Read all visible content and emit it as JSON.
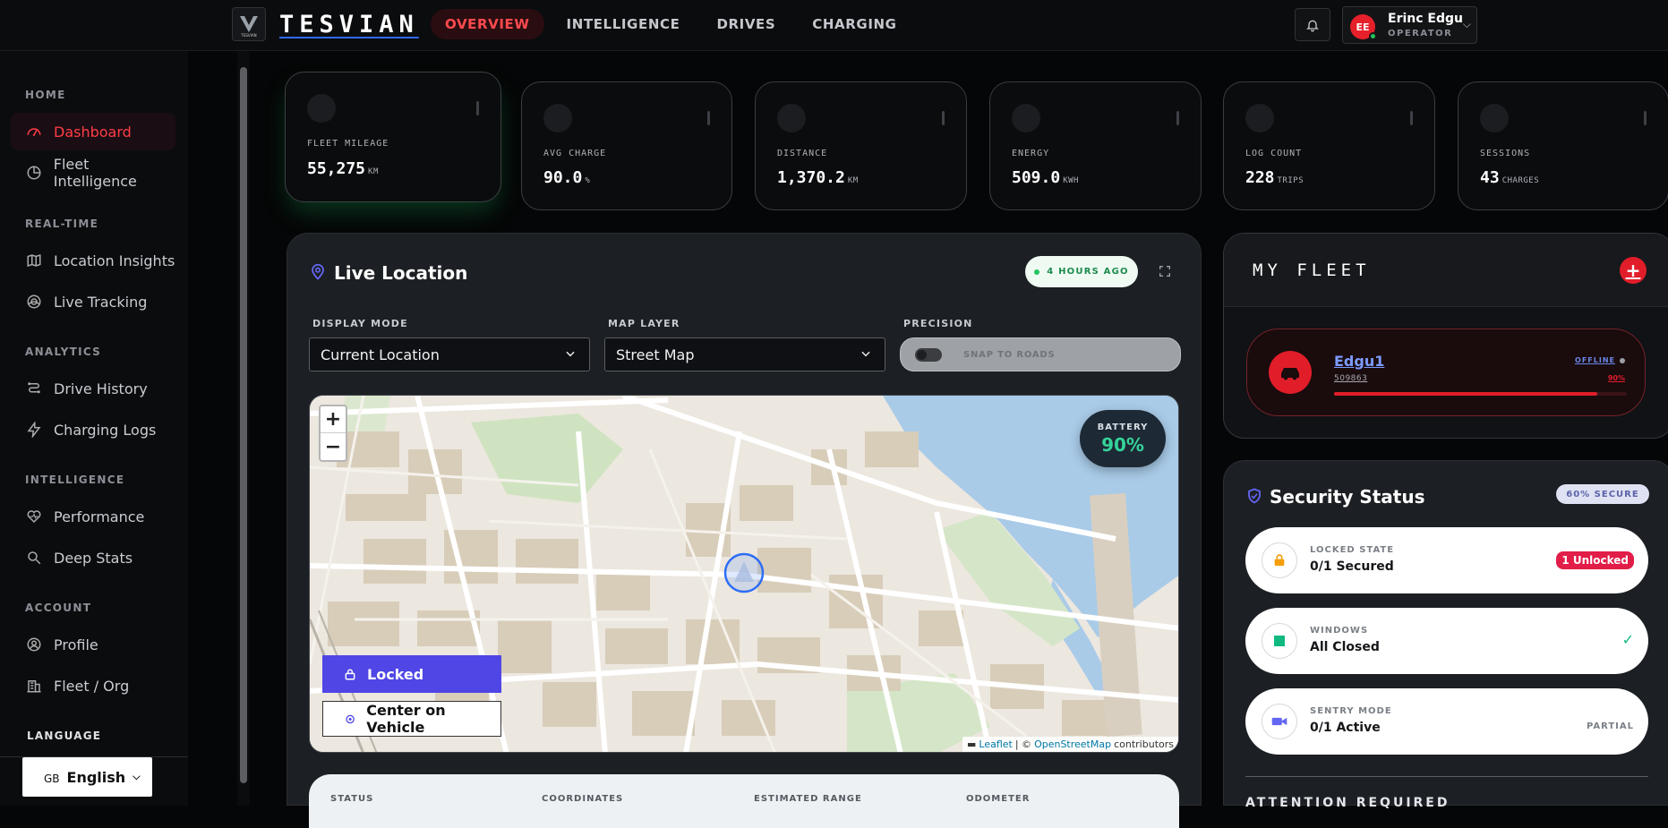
{
  "header": {
    "brand": "TESVIAN",
    "logo_text": "TESVIAN",
    "tabs": [
      {
        "label": "OVERVIEW",
        "active": true
      },
      {
        "label": "INTELLIGENCE",
        "active": false
      },
      {
        "label": "DRIVES",
        "active": false
      },
      {
        "label": "CHARGING",
        "active": false
      }
    ],
    "user": {
      "initials": "EE",
      "name": "Erinc Edgu",
      "role": "OPERATOR"
    }
  },
  "sidebar": {
    "sections": [
      {
        "title": "HOME",
        "items": [
          {
            "label": "Dashboard",
            "icon": "gauge-icon",
            "active": true
          },
          {
            "label": "Fleet Intelligence",
            "icon": "pie-chart-icon",
            "active": false
          }
        ]
      },
      {
        "title": "REAL-TIME",
        "items": [
          {
            "label": "Location Insights",
            "icon": "map-icon",
            "active": false
          },
          {
            "label": "Live Tracking",
            "icon": "radar-icon",
            "active": false
          }
        ]
      },
      {
        "title": "ANALYTICS",
        "items": [
          {
            "label": "Drive History",
            "icon": "route-icon",
            "active": false
          },
          {
            "label": "Charging Logs",
            "icon": "bolt-icon",
            "active": false
          }
        ]
      },
      {
        "title": "INTELLIGENCE",
        "items": [
          {
            "label": "Performance",
            "icon": "heart-pulse-icon",
            "active": false
          },
          {
            "label": "Deep Stats",
            "icon": "search-icon",
            "active": false
          }
        ]
      },
      {
        "title": "ACCOUNT",
        "items": [
          {
            "label": "Profile",
            "icon": "user-circle-icon",
            "active": false
          },
          {
            "label": "Fleet / Org",
            "icon": "building-icon",
            "active": false
          }
        ]
      }
    ],
    "language": {
      "label": "LANGUAGE",
      "flag": "GB",
      "value": "English"
    }
  },
  "stats": [
    {
      "label": "FLEET MILEAGE",
      "value": "55,275",
      "unit": "KM"
    },
    {
      "label": "AVG CHARGE",
      "value": "90.0",
      "unit": "%"
    },
    {
      "label": "DISTANCE",
      "value": "1,370.2",
      "unit": "KM"
    },
    {
      "label": "ENERGY",
      "value": "509.0",
      "unit": "KWH"
    },
    {
      "label": "LOG COUNT",
      "value": "228",
      "unit": "TRIPS"
    },
    {
      "label": "SESSIONS",
      "value": "43",
      "unit": "CHARGES"
    }
  ],
  "live_location": {
    "title": "Live Location",
    "updated": "4 HOURS AGO",
    "display_mode": {
      "label": "DISPLAY MODE",
      "value": "Current Location"
    },
    "map_layer": {
      "label": "MAP LAYER",
      "value": "Street Map"
    },
    "precision": {
      "label": "PRECISION",
      "toggle_label": "SNAP TO ROADS",
      "enabled": false
    },
    "battery": {
      "label": "BATTERY",
      "value": "90%"
    },
    "locked_label": "Locked",
    "center_label": "Center on Vehicle",
    "attribution": {
      "leaflet": "Leaflet",
      "sep": "| ©",
      "osm": "OpenStreetMap",
      "suffix": "contributors"
    },
    "info_columns": [
      "STATUS",
      "COORDINATES",
      "ESTIMATED RANGE",
      "ODOMETER"
    ]
  },
  "fleet": {
    "title": "MY FLEET",
    "add_label": "+",
    "vehicle": {
      "name": "Edgu1",
      "id": "509863",
      "status": "OFFLINE",
      "battery": "90%",
      "battery_fraction": 0.9
    }
  },
  "security": {
    "title": "Security Status",
    "score": "60% SECURE",
    "items": [
      {
        "label": "LOCKED STATE",
        "value": "0/1 Secured",
        "badge": "1 Unlocked"
      },
      {
        "label": "WINDOWS",
        "value": "All Closed",
        "badge": "✓"
      },
      {
        "label": "SENTRY MODE",
        "value": "0/1 Active",
        "badge": "PARTIAL"
      }
    ],
    "attention": "ATTENTION REQUIRED"
  },
  "colors": {
    "accent": "#e11d2a",
    "primary": "#4f46e5",
    "success": "#22c55e"
  }
}
